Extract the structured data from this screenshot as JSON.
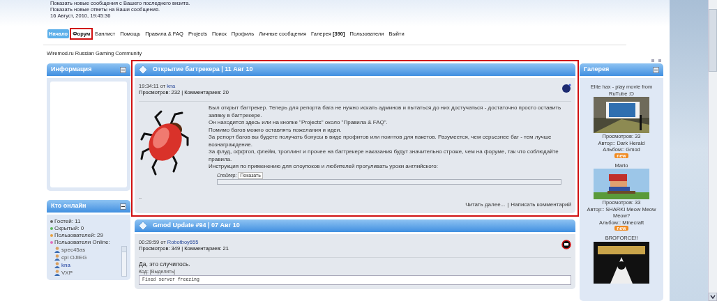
{
  "header": {
    "lines": [
      "Показать новые сообщения с Вашего последнего визита.",
      "Показать новые ответы на Ваши сообщения.",
      "16 Август, 2010, 19:45:36"
    ]
  },
  "nav": [
    {
      "label": "Начало",
      "selected": true,
      "highlighted": false
    },
    {
      "label": "Форум",
      "selected": false,
      "highlighted": true
    },
    {
      "label": "Банлист",
      "selected": false,
      "highlighted": false
    },
    {
      "label": "Помощь",
      "selected": false,
      "highlighted": false
    },
    {
      "label": "Правила & FAQ",
      "selected": false,
      "highlighted": false
    },
    {
      "label": "Projects",
      "selected": false,
      "highlighted": false
    },
    {
      "label": "Поиск",
      "selected": false,
      "highlighted": false
    },
    {
      "label": "Профиль",
      "selected": false,
      "highlighted": false
    },
    {
      "label": "Личные сообщения",
      "selected": false,
      "highlighted": false
    },
    {
      "label": "Галерея **[390]**",
      "selected": false,
      "highlighted": false
    },
    {
      "label": "Пользователи",
      "selected": false,
      "highlighted": false
    },
    {
      "label": "Выйти",
      "selected": false,
      "highlighted": false
    }
  ],
  "site_name": "Wiremod.ru Russian Gaming Community",
  "left_panels": [
    {
      "title": "Информация",
      "kind": "blank"
    },
    {
      "title": "Кто онлайн",
      "kind": "online",
      "stats": [
        {
          "text": "Гостей: 11",
          "color": "#666666"
        },
        {
          "text": "Скрытый: 0",
          "color": "#5cb85c"
        },
        {
          "text": "Пользователей: 29",
          "color": "#e8a040"
        },
        {
          "text": "Пользователи Online:",
          "color": "#e070c0"
        }
      ],
      "users": [
        {
          "name": "spec45as",
          "highlighted": false
        },
        {
          "name": "cpl OJIEG",
          "highlighted": false
        },
        {
          "name": "kna",
          "highlighted": true
        },
        {
          "name": "VXP",
          "highlighted": false
        }
      ]
    }
  ],
  "articles": [
    {
      "title": "Открытие багтрекера | 11 Авг 10",
      "time": "19:34:11 от",
      "author": "kna",
      "stats": "Просмотров: 232 | Комментариев: 20",
      "highlighted": true,
      "kind": "bug",
      "paragraphs": [
        "Был открыт багтрекер. Теперь для репорта бага не нужно искать админов и пытаться до них достучаться - достаточно просто оставить заявку в багтрекере.",
        "Он находится здесь или на кнопке \"Projects\" около \"Правила & FAQ\".",
        "Помимо багов можно оставлять пожелания и идеи.",
        "За репорт багов вы будете получать бонусы в виде профитов или поинтов для пакетов. Разумеется, чем серьезнее баг - тем лучше вознаграждение.",
        "За флуд, оффтоп, флейм, троллинг и прочее на багтрекере наказания будут значительно строже, чем на форуме, так что соблюдайте правила.",
        "Инструкция по применению для слоупоков и любителей прогуливать уроки английского:"
      ],
      "spoiler": {
        "label": "Спойлер:",
        "button": "Показать"
      },
      "ellipsis": "..",
      "links": [
        "Читать далее...",
        "Написать комментарий"
      ],
      "separator": "|"
    },
    {
      "title": "Gmod Update #94 | 07 Авг 10",
      "time": "00:29:59 от",
      "author": "Robotboy655",
      "stats": "Просмотров: 349 | Комментариев: 21",
      "highlighted": false,
      "kind": "text",
      "paragraphs": [
        "Да, это случилось."
      ],
      "code": {
        "label": "Код:",
        "select": "[Выделить]",
        "lines": [
          "Fixed server freezing"
        ]
      }
    }
  ],
  "gallery": {
    "title": "Галерея",
    "items": [
      {
        "title": "Elite hax - play movie from RuTube :D",
        "views": "Просмотров: 33",
        "author": "Автор:: Dark Herald",
        "album": "Альбом:: Gmod",
        "badge": "new",
        "kind": "room"
      },
      {
        "title": "Mario",
        "views": "Просмотров: 33",
        "author": "Автор:: SHARKI Meow Meow Meow?",
        "album": "Альбом:: Minecraft",
        "badge": "new",
        "kind": "mario"
      },
      {
        "title": "BROFORCE!!",
        "kind": "dark"
      }
    ]
  }
}
